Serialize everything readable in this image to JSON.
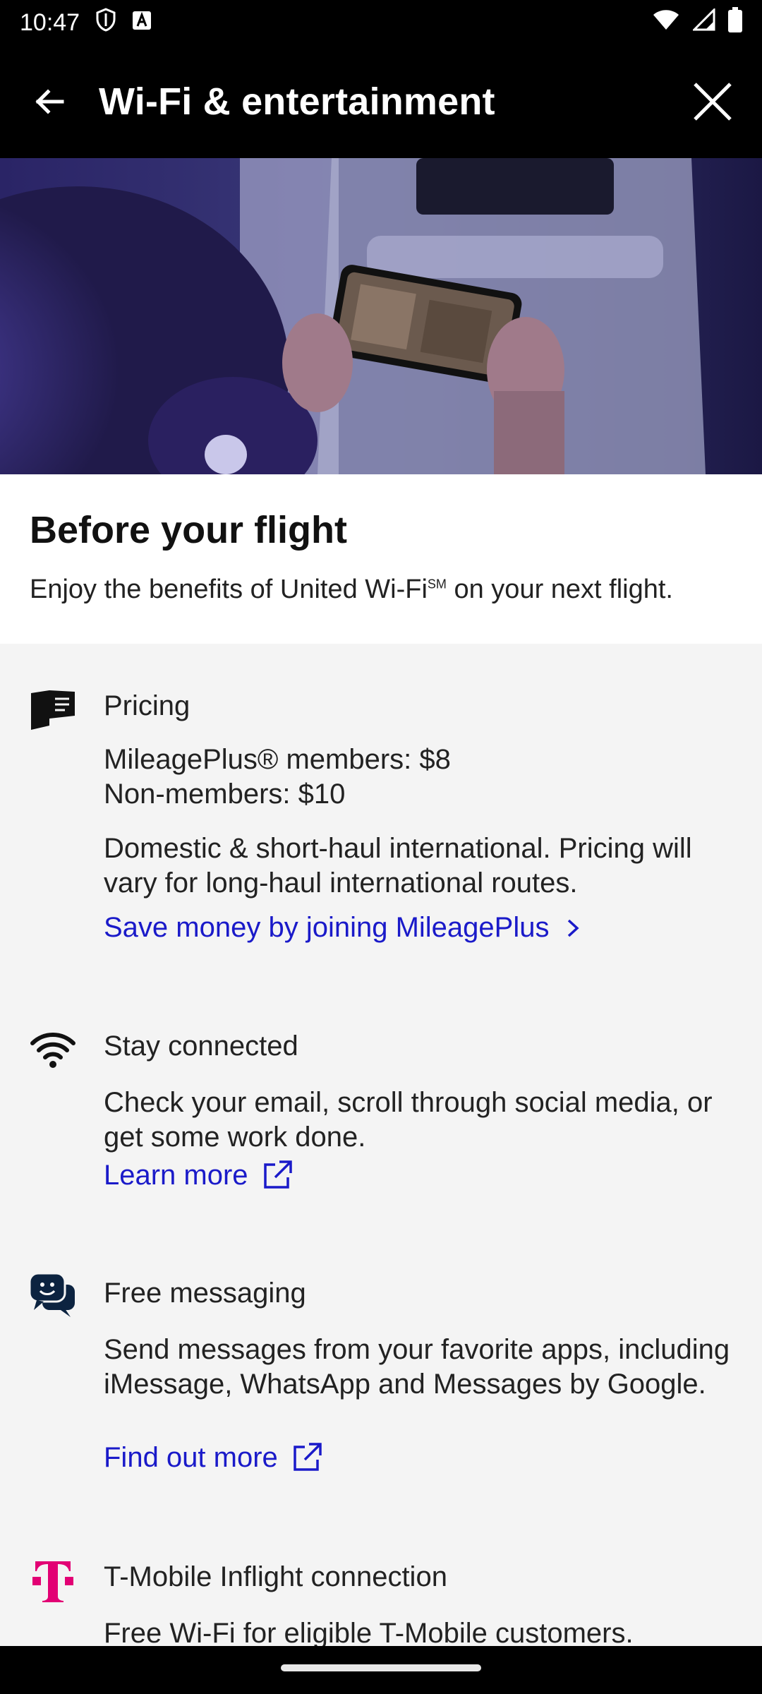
{
  "status_bar": {
    "time": "10:47"
  },
  "header": {
    "title": "Wi-Fi & entertainment"
  },
  "intro": {
    "heading": "Before your flight",
    "text": "Enjoy the benefits of United Wi-Fi",
    "text_mark": "SM",
    "text_end": " on your next flight."
  },
  "sections": {
    "pricing": {
      "title": "Pricing",
      "line1": "MileagePlus® members: $8",
      "line2": "Non-members: $10",
      "note": "Domestic & short-haul international. Pricing will vary for long-haul international routes.",
      "link": "Save money by joining MileagePlus"
    },
    "connected": {
      "title": "Stay connected",
      "text": "Check your email, scroll through social media, or get some work done.",
      "link": "Learn more"
    },
    "messaging": {
      "title": "Free messaging",
      "text": "Send messages from your favorite apps, including iMessage, WhatsApp and Messages by Google.",
      "link": "Find out more"
    },
    "tmobile": {
      "title": "T-Mobile Inflight connection",
      "text": "Free Wi-Fi for eligible T-Mobile customers."
    }
  },
  "colors": {
    "link": "#1a1ac9",
    "tmobile_magenta": "#e20074",
    "messaging_navy": "#0c2340"
  }
}
